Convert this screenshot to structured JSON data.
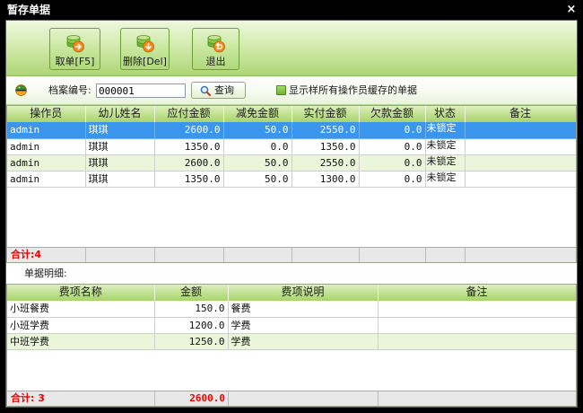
{
  "window": {
    "title": "暂存单据",
    "close_label": "×"
  },
  "toolbar": {
    "buttons": [
      {
        "label": "取单[F5]",
        "icon": "retrieve-icon"
      },
      {
        "label": "删除[Del]",
        "icon": "delete-icon"
      },
      {
        "label": "退出",
        "icon": "exit-icon"
      }
    ]
  },
  "search": {
    "icon": "indicator-icon",
    "label": "档案编号:",
    "value": "000001",
    "query_label": "查询",
    "query_icon": "magnifier-icon",
    "show_all_label": "显示样所有操作员缓存的单据"
  },
  "main_table": {
    "columns": [
      "操作员",
      "幼儿姓名",
      "应付金额",
      "减免金额",
      "实付金额",
      "欠款金额",
      "状态",
      "备注"
    ],
    "rows": [
      [
        "admin",
        "琪琪",
        "2600.0",
        "50.0",
        "2550.0",
        "0.0",
        "未锁定",
        ""
      ],
      [
        "admin",
        "琪琪",
        "1350.0",
        "0.0",
        "1350.0",
        "0.0",
        "未锁定",
        ""
      ],
      [
        "admin",
        "琪琪",
        "2600.0",
        "50.0",
        "2550.0",
        "0.0",
        "未锁定",
        ""
      ],
      [
        "admin",
        "琪琪",
        "1350.0",
        "50.0",
        "1300.0",
        "0.0",
        "未锁定",
        ""
      ]
    ],
    "selected_row": 0,
    "footer_label": "合计:4"
  },
  "detail": {
    "title": "单据明细:",
    "columns": [
      "费项名称",
      "金额",
      "费项说明",
      "备注"
    ],
    "rows": [
      [
        "小班餐费",
        "150.0",
        "餐费",
        ""
      ],
      [
        "小班学费",
        "1200.0",
        "学费",
        ""
      ],
      [
        "中班学费",
        "1250.0",
        "学费",
        ""
      ]
    ],
    "footer_label": "合计: 3",
    "footer_total": "2600.0"
  },
  "colors": {
    "title_bar": "#000000",
    "toolbar_green": "#aed577",
    "header_green": "#a8d36b",
    "selected_row": "#3a96ec",
    "alt_row": "#eaf5da",
    "total_text": "#ee0000"
  }
}
